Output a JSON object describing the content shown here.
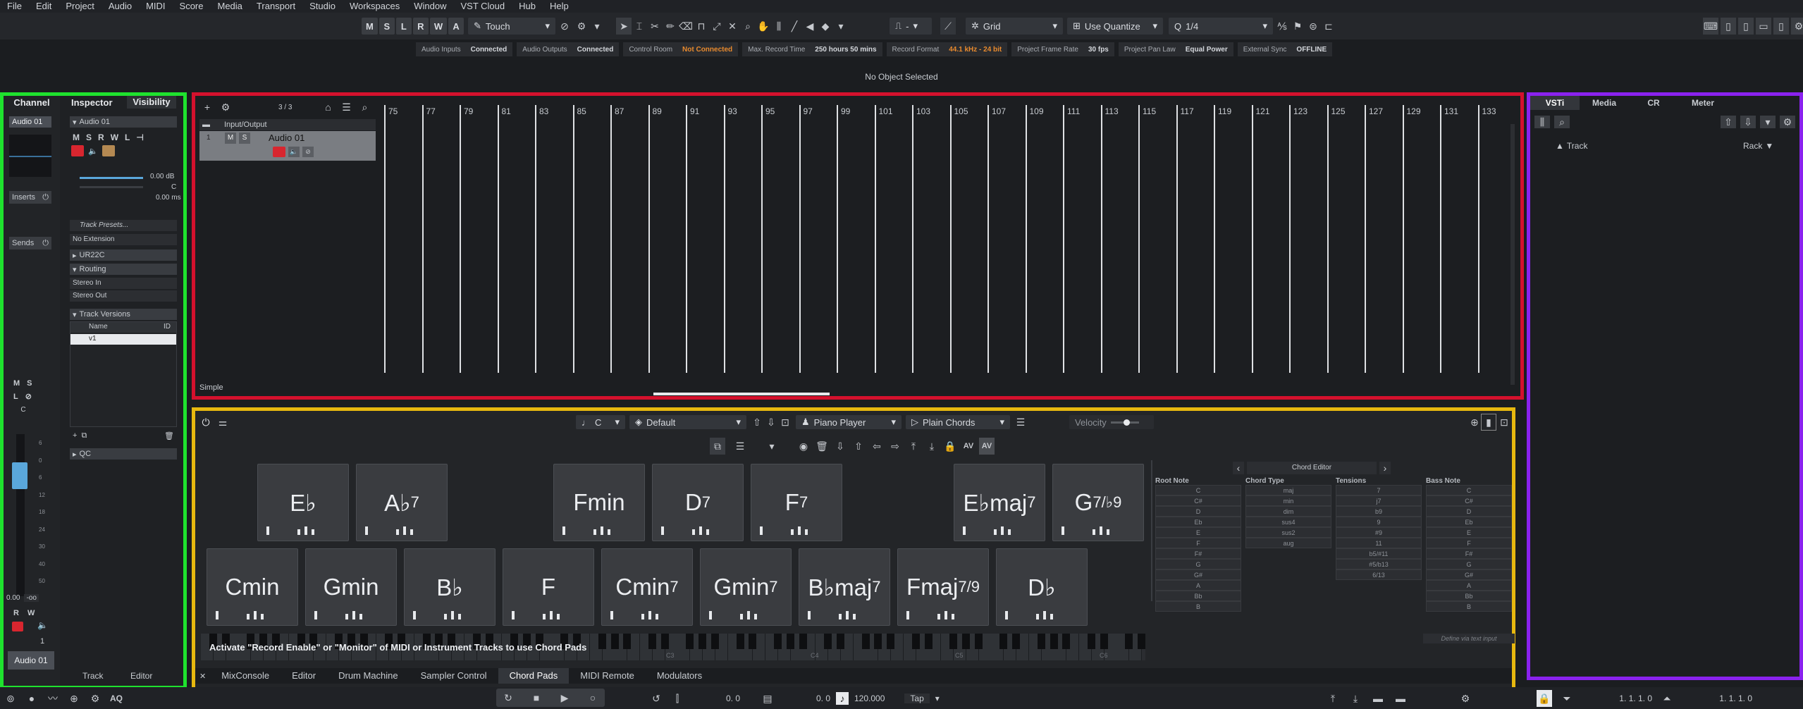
{
  "menu": [
    "File",
    "Edit",
    "Project",
    "Audio",
    "MIDI",
    "Score",
    "Media",
    "Transport",
    "Studio",
    "Workspaces",
    "Window",
    "VST Cloud",
    "Hub",
    "Help"
  ],
  "toolbar": {
    "state_buttons": [
      "M",
      "S",
      "L",
      "R",
      "W",
      "A"
    ],
    "automation_mode": "Touch",
    "snap_type": "Grid",
    "quantize_mode": "Use Quantize",
    "quantize_value": "1/4",
    "nudge_value": "-"
  },
  "status": [
    {
      "label": "Audio Inputs",
      "value": "Connected",
      "warn": false
    },
    {
      "label": "Audio Outputs",
      "value": "Connected",
      "warn": false
    },
    {
      "label": "Control Room",
      "value": "Not Connected",
      "warn": true
    },
    {
      "label": "Max. Record Time",
      "value": "250 hours 50 mins",
      "warn": false
    },
    {
      "label": "Record Format",
      "value": "44.1 kHz - 24 bit",
      "warn": true
    },
    {
      "label": "Project Frame Rate",
      "value": "30 fps",
      "warn": false
    },
    {
      "label": "Project Pan Law",
      "value": "Equal Power",
      "warn": false
    },
    {
      "label": "External Sync",
      "value": "OFFLINE",
      "warn": false
    }
  ],
  "info_line": "No Object Selected",
  "left_zone": {
    "tab_channel": "Channel",
    "tab_inspector": "Inspector",
    "tab_visibility": "Visibility",
    "channel_name": "Audio 01",
    "inserts": "Inserts",
    "sends": "Sends",
    "fader_value": "0.00",
    "fader_value2": "-oo",
    "channel_num": "1",
    "channel_bottom_name": "Audio 01",
    "inspector_track": "Audio 01",
    "volume": "0.00 dB",
    "pan": "C",
    "delay": "0.00 ms",
    "track_presets": "Track Presets...",
    "extension": "No Extension",
    "section_ur22c": "UR22C",
    "section_routing": "Routing",
    "routing_in": "Stereo In",
    "routing_out": "Stereo Out",
    "section_versions": "Track Versions",
    "versions_col_name": "Name",
    "versions_col_id": "ID",
    "version_1": "v1",
    "section_qc": "QC",
    "tab_track": "Track",
    "tab_editor": "Editor",
    "fader_scale": [
      "6",
      "0",
      "6",
      "12",
      "18",
      "24",
      "30",
      "40",
      "50"
    ]
  },
  "project": {
    "track_count": "3 / 3",
    "folder_name": "Input/Output",
    "track_name": "Audio 01",
    "track_num": "1",
    "ruler": [
      "75",
      "77",
      "79",
      "81",
      "83",
      "85",
      "87",
      "89",
      "91",
      "93",
      "95",
      "97",
      "99",
      "101",
      "103",
      "105",
      "107",
      "109",
      "111",
      "113",
      "115",
      "117",
      "119",
      "121",
      "123",
      "125",
      "127",
      "129",
      "131",
      "133"
    ],
    "mode_label": "Simple"
  },
  "lower": {
    "root": "C",
    "preset": "Default",
    "player": "Piano Player",
    "voicing": "Plain Chords",
    "velocity_label": "Velocity",
    "velocity_level": 0.55,
    "pads_top": [
      {
        "name": "E♭",
        "sup": ""
      },
      {
        "name": "A♭",
        "sup": "7"
      },
      {
        "name": "Fmin",
        "sup": ""
      },
      {
        "name": "D",
        "sup": "7"
      },
      {
        "name": "F",
        "sup": "7"
      },
      {
        "name": "E♭maj",
        "sup": "7"
      },
      {
        "name": "G",
        "sup": "7/♭9"
      }
    ],
    "pads_bottom": [
      {
        "name": "Cmin",
        "sup": ""
      },
      {
        "name": "Gmin",
        "sup": ""
      },
      {
        "name": "B♭",
        "sup": ""
      },
      {
        "name": "F",
        "sup": ""
      },
      {
        "name": "Cmin",
        "sup": "7"
      },
      {
        "name": "Gmin",
        "sup": "7"
      },
      {
        "name": "B♭maj",
        "sup": "7"
      },
      {
        "name": "Fmaj",
        "sup": "7/9"
      },
      {
        "name": "D♭",
        "sup": ""
      }
    ],
    "hint": "Activate \"Record Enable\" or \"Monitor\" of MIDI or Instrument Tracks to use Chord Pads",
    "keyboard_labels": [
      "C3",
      "C4",
      "C5",
      "C6"
    ],
    "chord_editor": {
      "title": "Chord Editor",
      "col_root": "Root Note",
      "col_type": "Chord Type",
      "col_tensions": "Tensions",
      "col_bass": "Bass Note",
      "roots": [
        "C",
        "C#",
        "D",
        "Eb",
        "E",
        "F",
        "F#",
        "G",
        "G#",
        "A",
        "Bb",
        "B"
      ],
      "types": [
        "maj",
        "min",
        "dim",
        "sus4",
        "sus2",
        "aug"
      ],
      "tensions": [
        "7",
        "j7",
        "b9",
        "9",
        "#9",
        "11",
        "b5/#11",
        "#5/b13",
        "6/13"
      ],
      "bass": [
        "C",
        "C#",
        "D",
        "Eb",
        "E",
        "F",
        "F#",
        "G",
        "G#",
        "A",
        "Bb",
        "B"
      ],
      "text_input": "Define via text input"
    },
    "tabs": [
      "MixConsole",
      "Editor",
      "Drum Machine",
      "Sampler Control",
      "Chord Pads",
      "MIDI Remote",
      "Modulators"
    ],
    "active_tab": "Chord Pads"
  },
  "right_zone": {
    "tabs": [
      "VSTi",
      "Media",
      "CR",
      "Meter"
    ],
    "track_label": "Track",
    "rack_label": "Rack"
  },
  "transport": {
    "pos1": "0.  0",
    "pos2": "0.  0",
    "tempo": "120.000",
    "tap": "Tap",
    "left_locator": "1. 1. 1.   0",
    "right_locator": "1. 1. 1.   0",
    "AQ": "AQ"
  },
  "colors": {
    "left_zone": "#1fe22e",
    "project": "#d4112d",
    "lower_zone": "#e7b80f",
    "right_zone": "#8a22ee",
    "record": "#d8262f",
    "warn": "#e88a2e"
  }
}
